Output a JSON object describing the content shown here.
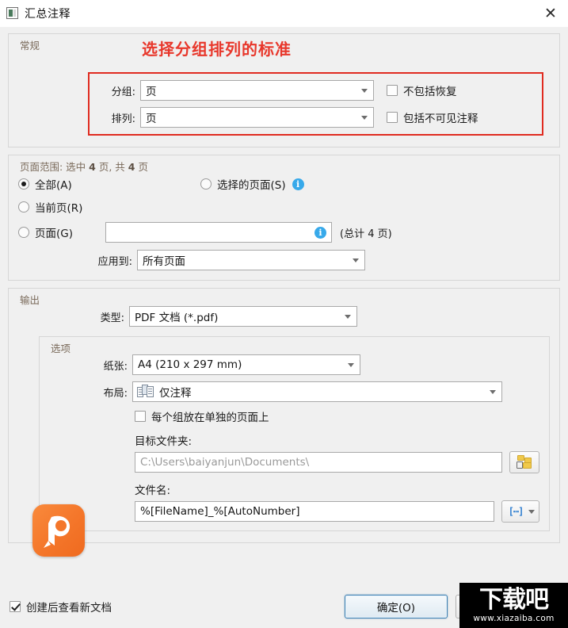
{
  "window": {
    "title": "汇总注释",
    "icon": "document-icon",
    "close_label": "✕"
  },
  "annotation": {
    "text": "选择分组排列的标准",
    "color": "#e8372b",
    "box_color": "#e02b20"
  },
  "general": {
    "group_label": "常规",
    "group_by_label": "分组:",
    "group_by_value": "页",
    "sort_by_label": "排列:",
    "sort_by_value": "页",
    "exclude_reply_label": "不包括恢复",
    "exclude_reply_checked": false,
    "include_hidden_label": "包括不可见注释",
    "include_hidden_checked": false
  },
  "page_range": {
    "header_prefix": "页面范围: 选中 ",
    "header_selected": "4",
    "header_mid": " 页, 共 ",
    "header_total": "4",
    "header_suffix": " 页",
    "all_label": "全部(A)",
    "all_checked": true,
    "selected_pages_label": "选择的页面(S)",
    "selected_pages_checked": false,
    "current_page_label": "当前页(R)",
    "current_page_checked": false,
    "pages_label": "页面(G)",
    "pages_checked": false,
    "pages_value": "",
    "pages_total_note": "(总计 4 页)",
    "apply_to_label": "应用到:",
    "apply_to_value": "所有页面"
  },
  "output": {
    "group_label": "输出",
    "type_label": "类型:",
    "type_value": "PDF 文档 (*.pdf)",
    "options_group_label": "选项",
    "paper_label": "纸张:",
    "paper_value": "A4 (210 x 297 mm)",
    "layout_label": "布局:",
    "layout_value": "仅注释",
    "layout_icon": "documents-stack-icon",
    "separate_page_label": "每个组放在单独的页面上",
    "separate_page_checked": false,
    "dest_folder_label": "目标文件夹:",
    "dest_folder_value": "C:\\Users\\baiyanjun\\Documents\\",
    "browse_icon": "folder-browse-icon",
    "filename_label": "文件名:",
    "filename_value": "%[FileName]_%[AutoNumber]",
    "macro_icon": "macro-brackets-icon"
  },
  "footer": {
    "view_after_create_label": "创建后查看新文档",
    "view_after_create_checked": true,
    "ok_label": "确定(O)",
    "cancel_label": ""
  },
  "watermark": {
    "main": "下载吧",
    "sub": "www.xiazaiba.com"
  },
  "branding": {
    "logo_name": "pdfelement-logo",
    "logo_color": "#f4762a"
  }
}
